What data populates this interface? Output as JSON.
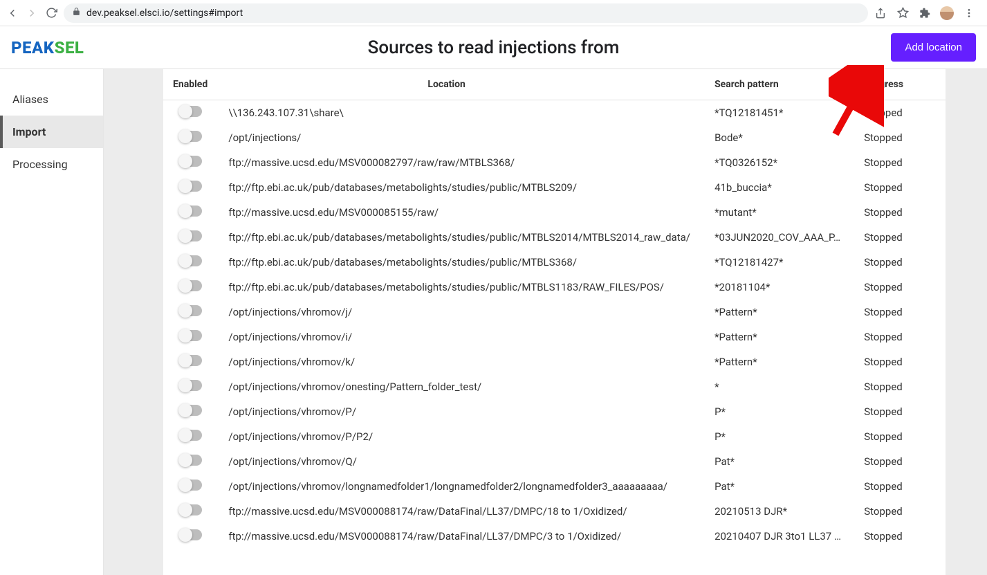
{
  "browser": {
    "url": "dev.peaksel.elsci.io/settings#import"
  },
  "logo": {
    "part1": "PEAK",
    "part2": "SEL"
  },
  "header": {
    "title": "Sources to read injections from",
    "add_button": "Add location"
  },
  "sidebar": {
    "items": [
      {
        "label": "Aliases",
        "active": false
      },
      {
        "label": "Import",
        "active": true
      },
      {
        "label": "Processing",
        "active": false
      }
    ]
  },
  "table": {
    "headers": {
      "enabled": "Enabled",
      "location": "Location",
      "pattern": "Search pattern",
      "progress": "Progress"
    },
    "rows": [
      {
        "location": "\\\\136.243.107.31\\share\\",
        "pattern": "*TQ12181451*",
        "progress": "Stopped"
      },
      {
        "location": "/opt/injections/",
        "pattern": "Bode*",
        "progress": "Stopped"
      },
      {
        "location": "ftp://massive.ucsd.edu/MSV000082797/raw/raw/MTBLS368/",
        "pattern": "*TQ0326152*",
        "progress": "Stopped"
      },
      {
        "location": "ftp://ftp.ebi.ac.uk/pub/databases/metabolights/studies/public/MTBLS209/",
        "pattern": "41b_buccia*",
        "progress": "Stopped"
      },
      {
        "location": "ftp://massive.ucsd.edu/MSV000085155/raw/",
        "pattern": "*mutant*",
        "progress": "Stopped"
      },
      {
        "location": "ftp://ftp.ebi.ac.uk/pub/databases/metabolights/studies/public/MTBLS2014/MTBLS2014_raw_data/",
        "pattern": "*03JUN2020_COV_AAA_P…",
        "progress": "Stopped"
      },
      {
        "location": "ftp://ftp.ebi.ac.uk/pub/databases/metabolights/studies/public/MTBLS368/",
        "pattern": "*TQ12181427*",
        "progress": "Stopped"
      },
      {
        "location": "ftp://ftp.ebi.ac.uk/pub/databases/metabolights/studies/public/MTBLS1183/RAW_FILES/POS/",
        "pattern": "*20181104*",
        "progress": "Stopped"
      },
      {
        "location": "/opt/injections/vhromov/j/",
        "pattern": "*Pattern*",
        "progress": "Stopped"
      },
      {
        "location": "/opt/injections/vhromov/i/",
        "pattern": "*Pattern*",
        "progress": "Stopped"
      },
      {
        "location": "/opt/injections/vhromov/k/",
        "pattern": "*Pattern*",
        "progress": "Stopped"
      },
      {
        "location": "/opt/injections/vhromov/onesting/Pattern_folder_test/",
        "pattern": "*",
        "progress": "Stopped"
      },
      {
        "location": "/opt/injections/vhromov/P/",
        "pattern": "P*",
        "progress": "Stopped"
      },
      {
        "location": "/opt/injections/vhromov/P/P2/",
        "pattern": "P*",
        "progress": "Stopped"
      },
      {
        "location": "/opt/injections/vhromov/Q/",
        "pattern": "Pat*",
        "progress": "Stopped"
      },
      {
        "location": "/opt/injections/vhromov/longnamedfolder1/longnamedfolder2/longnamedfolder3_aaaaaaaaa/",
        "pattern": "Pat*",
        "progress": "Stopped"
      },
      {
        "location": "ftp://massive.ucsd.edu/MSV000088174/raw/DataFinal/LL37/DMPC/18 to 1/Oxidized/",
        "pattern": "20210513 DJR*",
        "progress": "Stopped"
      },
      {
        "location": "ftp://massive.ucsd.edu/MSV000088174/raw/DataFinal/LL37/DMPC/3 to 1/Oxidized/",
        "pattern": "20210407 DJR 3to1 LL37 …",
        "progress": "Stopped"
      }
    ]
  }
}
